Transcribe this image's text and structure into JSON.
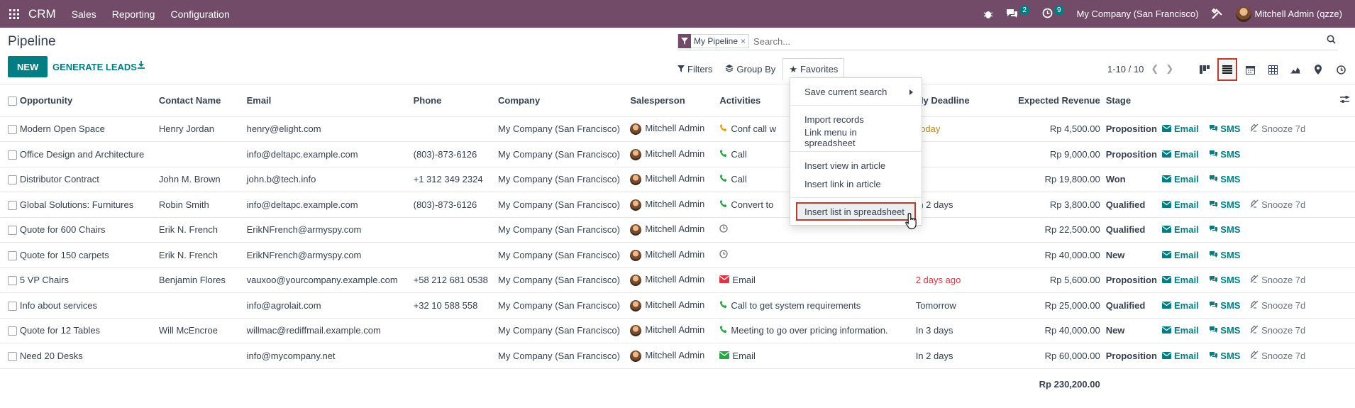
{
  "topbar": {
    "app": "CRM",
    "menus": [
      "Sales",
      "Reporting",
      "Configuration"
    ],
    "messages_count": "2",
    "activities_count": "9",
    "company": "My Company (San Francisco)",
    "user": "Mitchell Admin (qzze)"
  },
  "page": {
    "title": "Pipeline",
    "new_label": "NEW",
    "generate_label": "GENERATE LEADS"
  },
  "search": {
    "facet": "My Pipeline",
    "placeholder": "Search..."
  },
  "filters": {
    "filters_label": "Filters",
    "groupby_label": "Group By",
    "favorites_label": "Favorites"
  },
  "pager": {
    "text": "1-10 / 10"
  },
  "favorites_menu": {
    "save_current": "Save current search",
    "import_records": "Import records",
    "link_menu": "Link menu in spreadsheet",
    "insert_view": "Insert view in article",
    "insert_link": "Insert link in article",
    "insert_list": "Insert list in spreadsheet"
  },
  "table": {
    "headers": {
      "opportunity": "Opportunity",
      "contact": "Contact Name",
      "email": "Email",
      "phone": "Phone",
      "company": "Company",
      "salesperson": "Salesperson",
      "activities": "Activities",
      "deadline": "My Deadline",
      "revenue": "Expected Revenue",
      "stage": "Stage"
    },
    "row_actions": {
      "email": "Email",
      "sms": "SMS",
      "snooze": "Snooze 7d"
    },
    "rows": [
      {
        "opportunity": "Modern Open Space",
        "contact": "Henry Jordan",
        "email": "henry@elight.com",
        "phone": "",
        "company": "My Company (San Francisco)",
        "salesperson": "Mitchell Admin",
        "activity": "Conf call w",
        "deadline": "Today",
        "revenue": "Rp 4,500.00",
        "stage": "Proposition"
      },
      {
        "opportunity": "Office Design and Architecture",
        "contact": "",
        "email": "info@deltapc.example.com",
        "phone": "(803)-873-6126",
        "company": "My Company (San Francisco)",
        "salesperson": "Mitchell Admin",
        "activity": "Call",
        "deadline": "",
        "revenue": "Rp 9,000.00",
        "stage": "Proposition"
      },
      {
        "opportunity": "Distributor Contract",
        "contact": "John M. Brown",
        "email": "john.b@tech.info",
        "phone": "+1 312 349 2324",
        "company": "My Company (San Francisco)",
        "salesperson": "Mitchell Admin",
        "activity": "Call",
        "deadline": "",
        "revenue": "Rp 19,800.00",
        "stage": "Won"
      },
      {
        "opportunity": "Global Solutions: Furnitures",
        "contact": "Robin Smith",
        "email": "info@deltapc.example.com",
        "phone": "(803)-873-6126",
        "company": "My Company (San Francisco)",
        "salesperson": "Mitchell Admin",
        "activity": "Convert to",
        "deadline": "In 2 days",
        "revenue": "Rp 3,800.00",
        "stage": "Qualified"
      },
      {
        "opportunity": "Quote for 600 Chairs",
        "contact": "Erik N. French",
        "email": "ErikNFrench@armyspy.com",
        "phone": "",
        "company": "My Company (San Francisco)",
        "salesperson": "Mitchell Admin",
        "activity": "",
        "deadline": "",
        "revenue": "Rp 22,500.00",
        "stage": "Qualified"
      },
      {
        "opportunity": "Quote for 150 carpets",
        "contact": "Erik N. French",
        "email": "ErikNFrench@armyspy.com",
        "phone": "",
        "company": "My Company (San Francisco)",
        "salesperson": "Mitchell Admin",
        "activity": "",
        "deadline": "",
        "revenue": "Rp 40,000.00",
        "stage": "New"
      },
      {
        "opportunity": "5 VP Chairs",
        "contact": "Benjamin Flores",
        "email": "vauxoo@yourcompany.example.com",
        "phone": "+58 212 681 0538",
        "company": "My Company (San Francisco)",
        "salesperson": "Mitchell Admin",
        "activity": "Email",
        "deadline": "2 days ago",
        "revenue": "Rp 5,600.00",
        "stage": "Proposition"
      },
      {
        "opportunity": "Info about services",
        "contact": "",
        "email": "info@agrolait.com",
        "phone": "+32 10 588 558",
        "company": "My Company (San Francisco)",
        "salesperson": "Mitchell Admin",
        "activity": "Call to get system requirements",
        "deadline": "Tomorrow",
        "revenue": "Rp 25,000.00",
        "stage": "Qualified"
      },
      {
        "opportunity": "Quote for 12 Tables",
        "contact": "Will McEncroe",
        "email": "willmac@rediffmail.example.com",
        "phone": "",
        "company": "My Company (San Francisco)",
        "salesperson": "Mitchell Admin",
        "activity": "Meeting to go over pricing information.",
        "deadline": "In 3 days",
        "revenue": "Rp 40,000.00",
        "stage": "New"
      },
      {
        "opportunity": "Need 20 Desks",
        "contact": "",
        "email": "info@mycompany.net",
        "phone": "",
        "company": "My Company (San Francisco)",
        "salesperson": "Mitchell Admin",
        "activity": "Email",
        "deadline": "In 2 days",
        "revenue": "Rp 60,000.00",
        "stage": "Proposition"
      }
    ],
    "total_revenue": "Rp 230,200.00"
  }
}
